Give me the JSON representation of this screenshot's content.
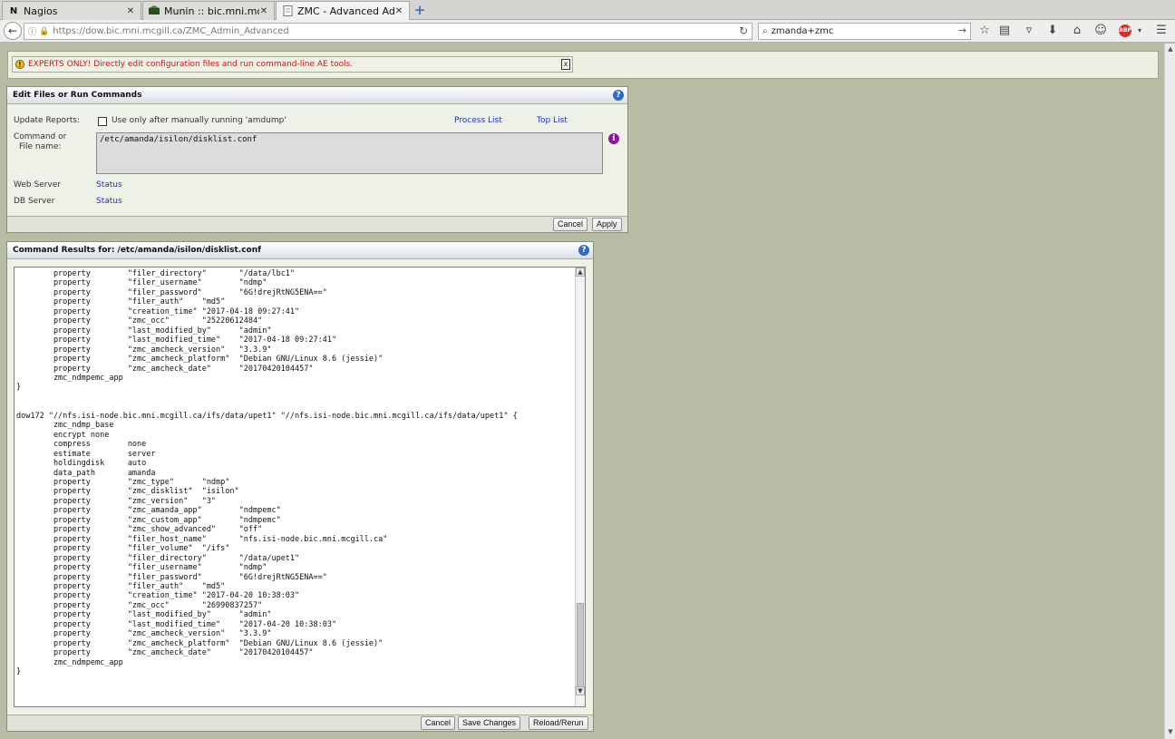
{
  "browser": {
    "tabs": [
      {
        "label": "Nagios",
        "favicon": "N"
      },
      {
        "label": "Munin :: bic.mni.mcgill...",
        "favicon": "munin-icon"
      },
      {
        "label": "ZMC - Advanced Ad...",
        "favicon": "page-icon"
      }
    ],
    "url": "https://dow.bic.mni.mcgill.ca/ZMC_Admin_Advanced",
    "search_value": "zmanda+zmc"
  },
  "warning": {
    "text": "EXPERTS ONLY! Directly edit configuration files and run command-line AE tools.",
    "close_label": "x"
  },
  "edit_panel": {
    "title": "Edit Files or Run Commands",
    "update_reports_label": "Update Reports:",
    "checkbox_label": "Use only after manually running 'amdump'",
    "process_list_link": "Process List",
    "top_list_link": "Top List",
    "command_label_1": "Command or",
    "command_label_2": "File name:",
    "command_value": "/etc/amanda/isilon/disklist.conf",
    "web_server_label": "Web Server",
    "web_server_link": "Status",
    "db_server_label": "DB Server",
    "db_server_link": "Status",
    "cancel_label": "Cancel",
    "apply_label": "Apply"
  },
  "results_panel": {
    "title": "Command Results for: /etc/amanda/isilon/disklist.conf",
    "content": "        property        \"filer_directory\"       \"/data/lbc1\"\n        property        \"filer_username\"        \"ndmp\"\n        property        \"filer_password\"        \"6G!drejRtNG5ENA==\"\n        property        \"filer_auth\"    \"md5\"\n        property        \"creation_time\" \"2017-04-18 09:27:41\"\n        property        \"zmc_occ\"       \"25220612484\"\n        property        \"last_modified_by\"      \"admin\"\n        property        \"last_modified_time\"    \"2017-04-18 09:27:41\"\n        property        \"zmc_amcheck_version\"   \"3.3.9\"\n        property        \"zmc_amcheck_platform\"  \"Debian GNU/Linux 8.6 (jessie)\"\n        property        \"zmc_amcheck_date\"      \"20170420104457\"\n        zmc_ndmpemc_app\n}\n\n\ndow172 \"//nfs.isi-node.bic.mni.mcgill.ca/ifs/data/upet1\" \"//nfs.isi-node.bic.mni.mcgill.ca/ifs/data/upet1\" {\n        zmc_ndmp_base\n        encrypt none\n        compress        none\n        estimate        server\n        holdingdisk     auto\n        data_path       amanda\n        property        \"zmc_type\"      \"ndmp\"\n        property        \"zmc_disklist\"  \"isilon\"\n        property        \"zmc_version\"   \"3\"\n        property        \"zmc_amanda_app\"        \"ndmpemc\"\n        property        \"zmc_custom_app\"        \"ndmpemc\"\n        property        \"zmc_show_advanced\"     \"off\"\n        property        \"filer_host_name\"       \"nfs.isi-node.bic.mni.mcgill.ca\"\n        property        \"filer_volume\"  \"/ifs\"\n        property        \"filer_directory\"       \"/data/upet1\"\n        property        \"filer_username\"        \"ndmp\"\n        property        \"filer_password\"        \"6G!drejRtNG5ENA==\"\n        property        \"filer_auth\"    \"md5\"\n        property        \"creation_time\" \"2017-04-20 10:38:03\"\n        property        \"zmc_occ\"       \"26990837257\"\n        property        \"last_modified_by\"      \"admin\"\n        property        \"last_modified_time\"    \"2017-04-20 10:38:03\"\n        property        \"zmc_amcheck_version\"   \"3.3.9\"\n        property        \"zmc_amcheck_platform\"  \"Debian GNU/Linux 8.6 (jessie)\"\n        property        \"zmc_amcheck_date\"      \"20170420104457\"\n        zmc_ndmpemc_app\n}",
    "cancel_label": "Cancel",
    "save_label": "Save Changes",
    "reload_label": "Reload/Rerun"
  }
}
